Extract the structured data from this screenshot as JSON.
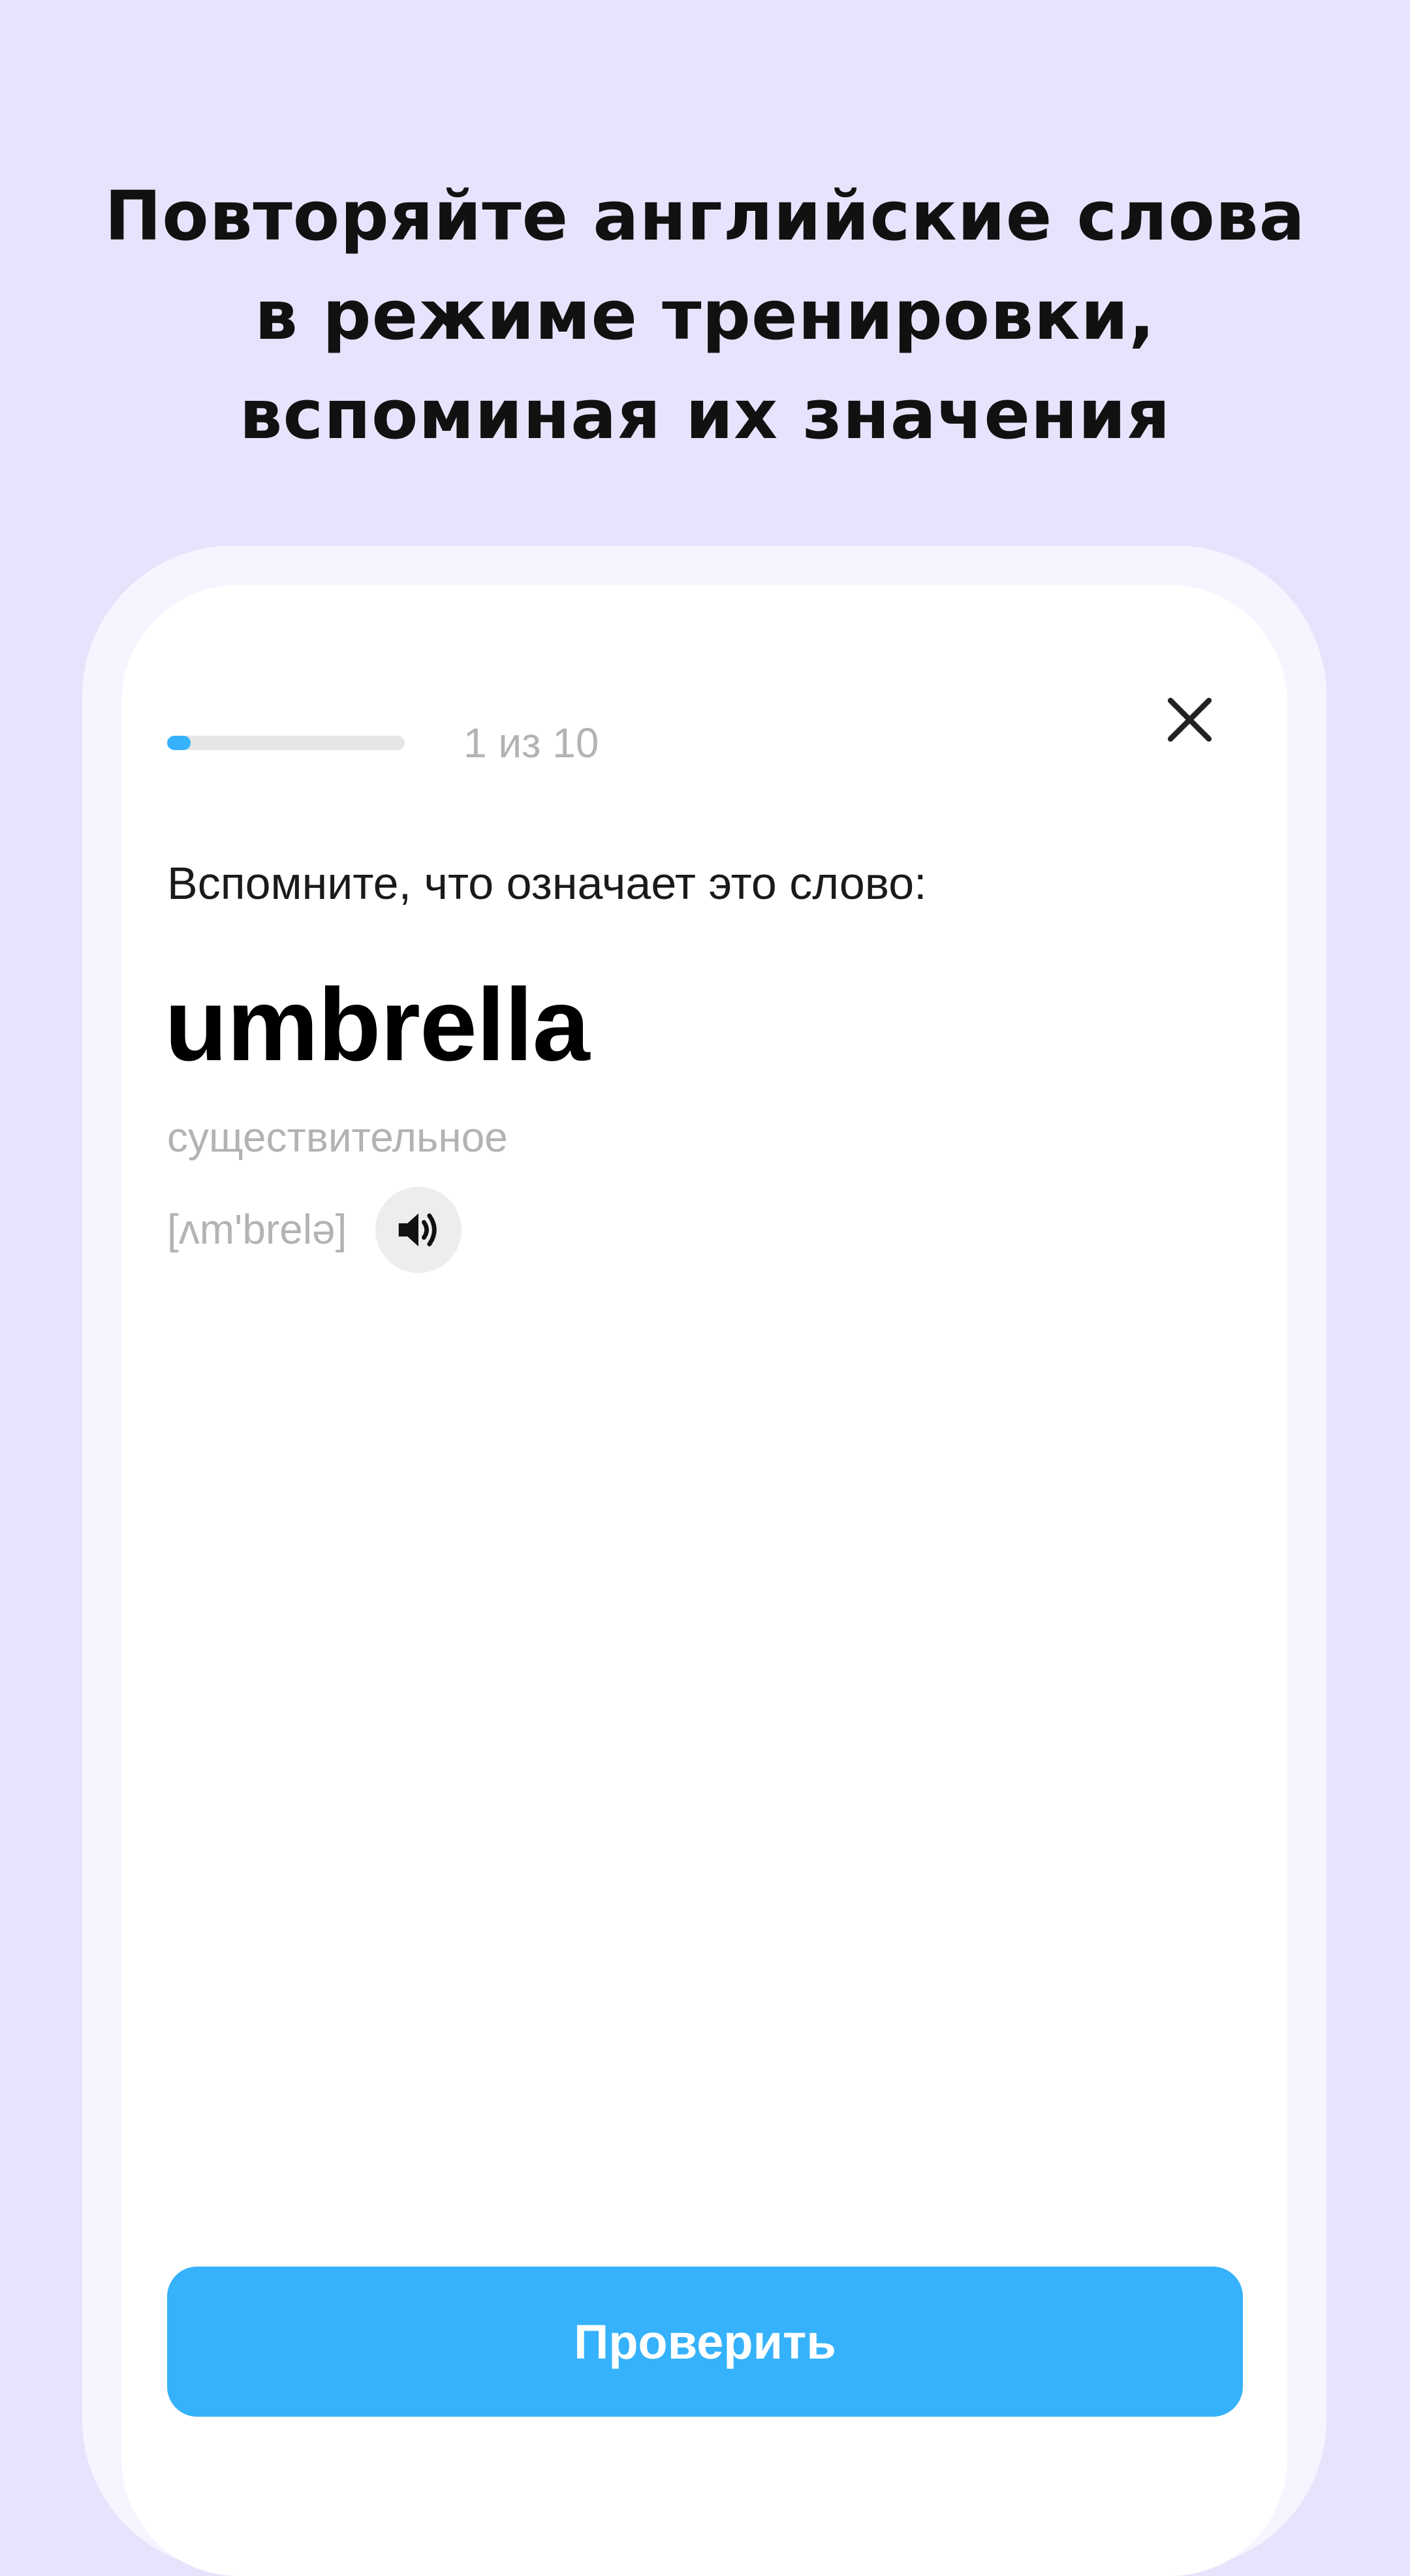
{
  "headline": {
    "lines": [
      "Повторяйте английские слова",
      "в режиме тренировки,",
      "вспоминая их значения"
    ]
  },
  "quiz": {
    "progress_text": "1 из 10",
    "progress_fraction": 0.1,
    "close_icon": "close-icon",
    "prompt": "Вспомните, что означает это слово:",
    "word": "umbrella",
    "part_of_speech": "существительное",
    "transcription": "[ʌm'brelə]",
    "sound_icon": "speaker-icon",
    "check_button_label": "Проверить"
  },
  "colors": {
    "background": "#e8e3fd",
    "accent": "#35b2fb",
    "muted_text": "#b3b3b3"
  }
}
